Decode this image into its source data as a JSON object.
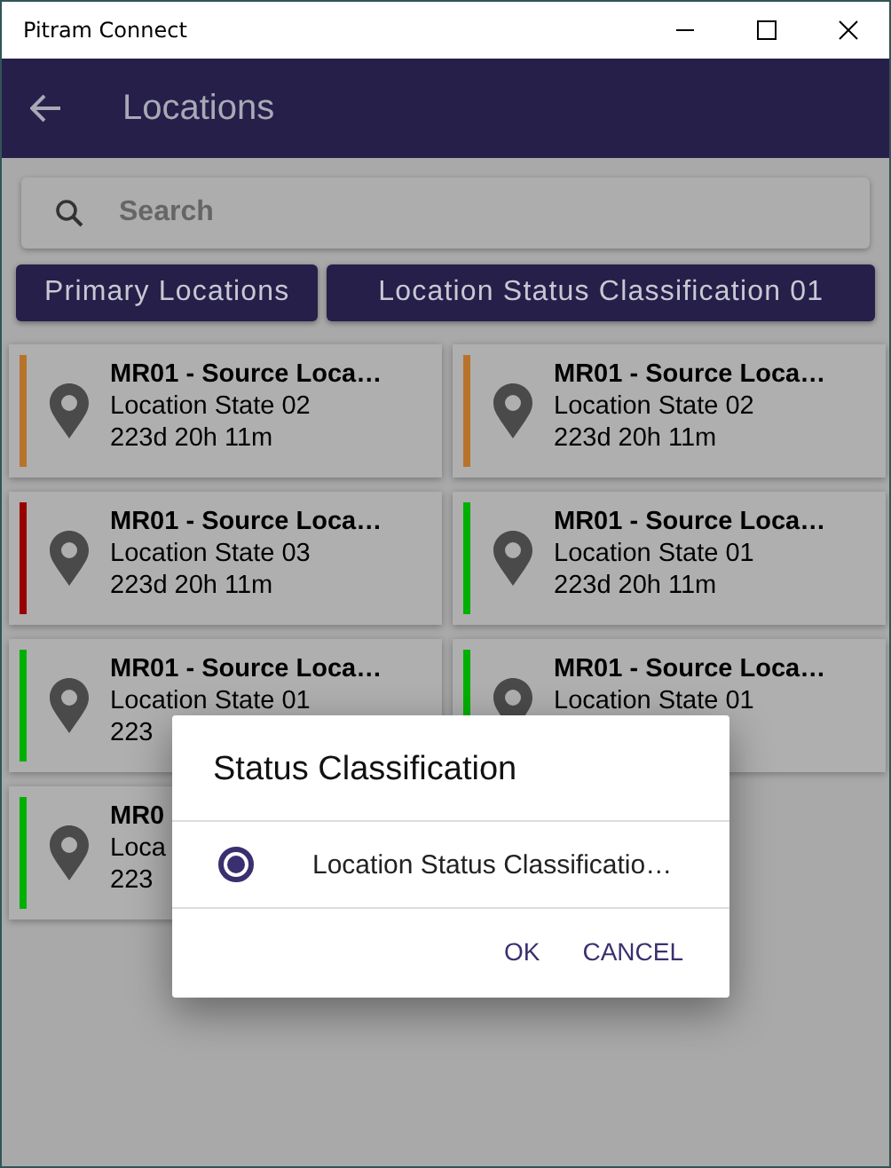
{
  "window": {
    "title": "Pitram Connect"
  },
  "app_bar": {
    "title": "Locations"
  },
  "search": {
    "placeholder": "Search"
  },
  "filters": [
    {
      "label": "Primary Locations"
    },
    {
      "label": "Location Status Classification 01"
    }
  ],
  "locations": [
    {
      "name": "MR01 - Source Loca…",
      "state": "Location State 02",
      "duration": "223d 20h 11m",
      "color": "#b8732b"
    },
    {
      "name": "MR01 - Source Loca…",
      "state": "Location State 02",
      "duration": "223d 20h 11m",
      "color": "#b8732b"
    },
    {
      "name": "MR01 - Source Loca…",
      "state": "Location State 03",
      "duration": "223d 20h 11m",
      "color": "#990000"
    },
    {
      "name": "MR01 - Source Loca…",
      "state": "Location State 01",
      "duration": "223d 20h 11m",
      "color": "#00b000"
    },
    {
      "name": "MR01 - Source Loca…",
      "state": "Location State 01",
      "duration": "223",
      "color": "#00b000"
    },
    {
      "name": "MR01 - Source Loca…",
      "state": "Location State 01",
      "color": "#00b000"
    },
    {
      "name": "MR0",
      "state": "Loca",
      "duration": "223",
      "color": "#00b000"
    }
  ],
  "dialog": {
    "title": "Status Classification",
    "options": [
      {
        "label": "Location Status Classificatio…",
        "selected": true
      }
    ],
    "buttons": [
      "OK",
      "CANCEL"
    ]
  }
}
